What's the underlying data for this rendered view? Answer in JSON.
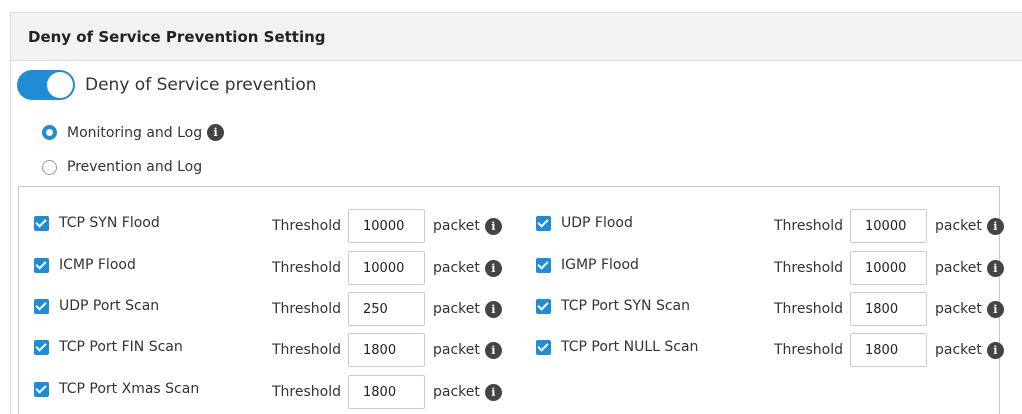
{
  "panel": {
    "title": "Deny of Service Prevention Setting"
  },
  "toggle": {
    "label": "Deny of Service prevention",
    "enabled": true
  },
  "modes": [
    {
      "label": "Monitoring and Log",
      "selected": true,
      "has_info": true
    },
    {
      "label": "Prevention and Log",
      "selected": false,
      "has_info": false
    }
  ],
  "threshold_label": "Threshold",
  "unit_label": "packet",
  "attacks": [
    {
      "label": "TCP SYN Flood",
      "checked": true,
      "threshold": "10000"
    },
    {
      "label": "UDP Flood",
      "checked": true,
      "threshold": "10000"
    },
    {
      "label": "ICMP Flood",
      "checked": true,
      "threshold": "10000"
    },
    {
      "label": "IGMP Flood",
      "checked": true,
      "threshold": "10000"
    },
    {
      "label": "UDP Port Scan",
      "checked": true,
      "threshold": "250"
    },
    {
      "label": "TCP Port SYN Scan",
      "checked": true,
      "threshold": "1800"
    },
    {
      "label": "TCP Port FIN Scan",
      "checked": true,
      "threshold": "1800"
    },
    {
      "label": "TCP Port NULL Scan",
      "checked": true,
      "threshold": "1800"
    },
    {
      "label": "TCP Port Xmas Scan",
      "checked": true,
      "threshold": "1800"
    }
  ],
  "colors": {
    "accent": "#1f8dd6",
    "info_icon": "#444444",
    "header_bg": "#f2f2f2"
  },
  "icons": {
    "info": "info-icon",
    "checkbox": "checkbox-checked-icon"
  }
}
